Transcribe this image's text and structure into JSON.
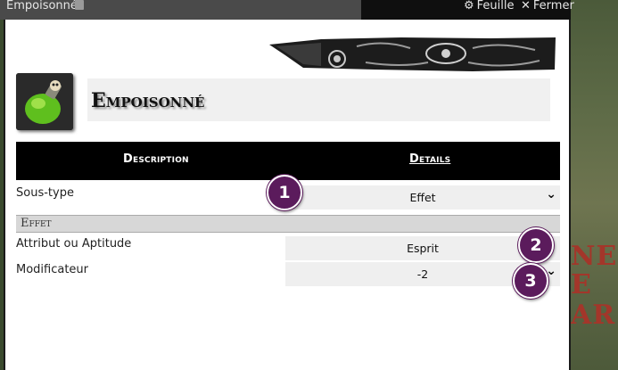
{
  "window": {
    "title": "Empoisonné",
    "title_icon": "book-icon",
    "sheet_label": "Feuille",
    "sheet_icon": "gear-icon",
    "close_label": "Fermer",
    "close_icon": "close-icon"
  },
  "item": {
    "name": "Empoisonné",
    "icon": "poison-potion-icon"
  },
  "tabs": [
    {
      "label": "Description",
      "active": false
    },
    {
      "label": "Details",
      "active": true
    }
  ],
  "fields": {
    "subtype": {
      "label": "Sous-type",
      "value": "Effet"
    },
    "section_title": "Effet",
    "attribute": {
      "label": "Attribut ou Aptitude",
      "value": "Esprit"
    },
    "modifier": {
      "label": "Modificateur",
      "value": "-2"
    }
  },
  "annotations": [
    "1",
    "2",
    "3"
  ],
  "background_text": [
    "NES",
    "E",
    "AR"
  ],
  "colors": {
    "badge": "#5b1b5c",
    "tabbar": "#000000",
    "background_title": "#a3362a"
  }
}
